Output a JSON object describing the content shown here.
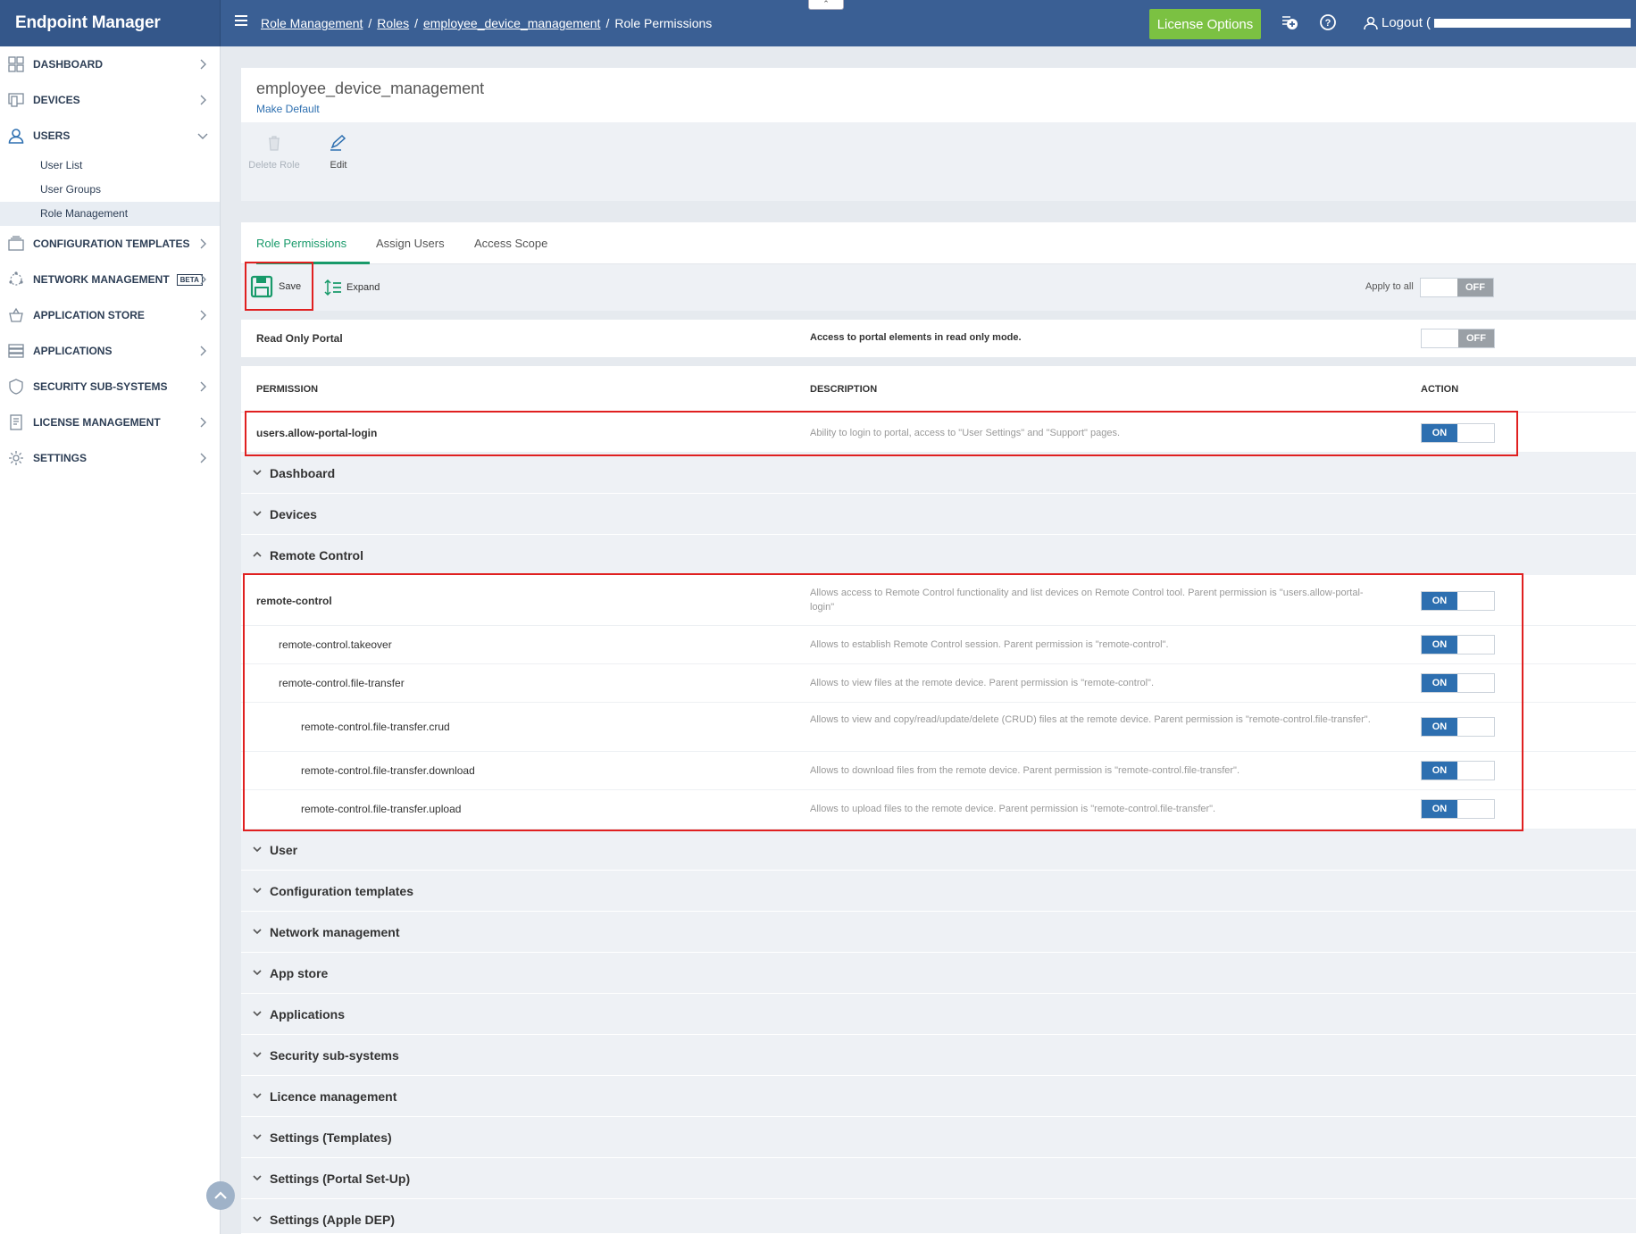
{
  "app": {
    "title": "Endpoint Manager"
  },
  "breadcrumb": {
    "items": [
      "Role Management",
      "Roles",
      "employee_device_management"
    ],
    "current": "Role Permissions",
    "separator": "/"
  },
  "topbar": {
    "license_label": "License Options",
    "logout_label": "Logout (",
    "icons": [
      "add-circle-icon",
      "help-icon",
      "user-icon"
    ]
  },
  "sidebar": {
    "items": [
      {
        "label": "DASHBOARD",
        "icon": "dashboard-icon"
      },
      {
        "label": "DEVICES",
        "icon": "devices-icon"
      },
      {
        "label": "USERS",
        "icon": "user-icon"
      },
      {
        "label": "CONFIGURATION TEMPLATES",
        "icon": "templates-icon"
      },
      {
        "label": "NETWORK MANAGEMENT",
        "icon": "network-icon",
        "badge": "BETA"
      },
      {
        "label": "APPLICATION STORE",
        "icon": "store-icon"
      },
      {
        "label": "APPLICATIONS",
        "icon": "applications-icon"
      },
      {
        "label": "SECURITY SUB-SYSTEMS",
        "icon": "shield-icon"
      },
      {
        "label": "LICENSE MANAGEMENT",
        "icon": "license-icon"
      },
      {
        "label": "SETTINGS",
        "icon": "gear-icon"
      }
    ],
    "users_sub": [
      "User List",
      "User Groups",
      "Role Management"
    ]
  },
  "role": {
    "name": "employee_device_management",
    "make_default": "Make Default"
  },
  "toolbar": {
    "delete_label": "Delete Role",
    "edit_label": "Edit"
  },
  "tabs": [
    "Role Permissions",
    "Assign Users",
    "Access Scope"
  ],
  "actions": {
    "save_label": "Save",
    "expand_label": "Expand",
    "apply_all_label": "Apply to all",
    "apply_all_state": "OFF"
  },
  "readonly": {
    "label": "Read Only Portal",
    "description": "Access to portal elements in read only mode.",
    "state": "OFF"
  },
  "table": {
    "headers": {
      "permission": "PERMISSION",
      "description": "DESCRIPTION",
      "action": "ACTION"
    },
    "top_permission": {
      "name": "users.allow-portal-login",
      "description": "Ability to login to portal, access to \"User Settings\" and \"Support\" pages.",
      "state": "ON"
    },
    "remote_rows": [
      {
        "name": "remote-control",
        "description": "Allows access to Remote Control functionality and list devices on Remote Control tool. Parent permission is \"users.allow-portal-login\"",
        "state": "ON"
      },
      {
        "name": "remote-control.takeover",
        "description": "Allows to establish Remote Control session. Parent permission is \"remote-control\".",
        "state": "ON"
      },
      {
        "name": "remote-control.file-transfer",
        "description": "Allows to view files at the remote device. Parent permission is \"remote-control\".",
        "state": "ON"
      },
      {
        "name": "remote-control.file-transfer.crud",
        "description": "Allows to view and copy/read/update/delete (CRUD) files at the remote device. Parent permission is \"remote-control.file-transfer\".",
        "state": "ON"
      },
      {
        "name": "remote-control.file-transfer.download",
        "description": "Allows to download files from the remote device. Parent permission is \"remote-control.file-transfer\".",
        "state": "ON"
      },
      {
        "name": "remote-control.file-transfer.upload",
        "description": "Allows to upload files to the remote device. Parent permission is \"remote-control.file-transfer\".",
        "state": "ON"
      }
    ],
    "groups_before": [
      "Dashboard",
      "Devices"
    ],
    "expanded_group": "Remote Control",
    "groups_after": [
      "User",
      "Configuration templates",
      "Network management",
      "App store",
      "Applications",
      "Security sub-systems",
      "Licence management",
      "Settings (Templates)",
      "Settings (Portal Set-Up)",
      "Settings (Apple DEP)"
    ]
  },
  "colors": {
    "topbar": "#3a5f94",
    "license_button": "#7bc142",
    "toggle_on": "#2d6fb0",
    "toggle_off": "#9aa0a6",
    "active_tab": "#189a6a",
    "highlight_box": "#e02020"
  }
}
